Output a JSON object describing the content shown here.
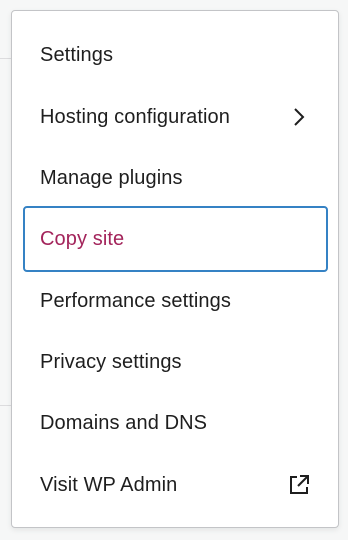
{
  "menu": {
    "items": [
      {
        "label": "Settings",
        "icon": null,
        "focused": false
      },
      {
        "label": "Hosting configuration",
        "icon": "chevron-right-icon",
        "focused": false
      },
      {
        "label": "Manage plugins",
        "icon": null,
        "focused": false
      },
      {
        "label": "Copy site",
        "icon": null,
        "focused": true
      },
      {
        "label": "Performance settings",
        "icon": null,
        "focused": false
      },
      {
        "label": "Privacy settings",
        "icon": null,
        "focused": false
      },
      {
        "label": "Domains and DNS",
        "icon": null,
        "focused": false
      },
      {
        "label": "Visit WP Admin",
        "icon": "external-link-icon",
        "focused": false
      }
    ]
  },
  "colors": {
    "text": "#1e1e1e",
    "focused_text": "#a3245b",
    "focus_ring": "#3582c4",
    "menu_border": "#c3c4c7",
    "page_bg": "#f6f7f7"
  }
}
